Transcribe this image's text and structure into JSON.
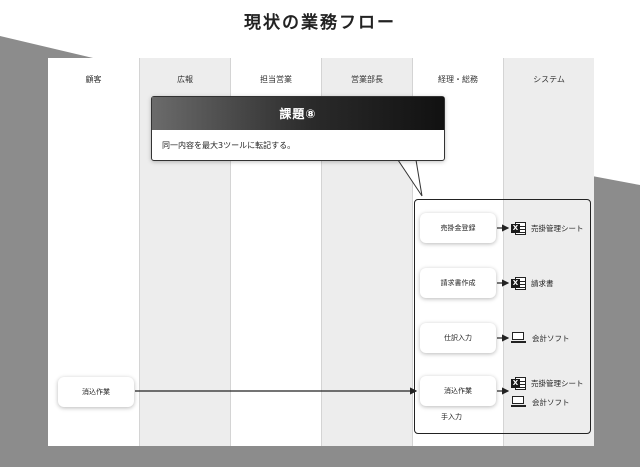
{
  "title": "現状の業務フロー",
  "lanes": [
    "顧客",
    "広報",
    "担当営業",
    "営業部長",
    "経理・総務",
    "システム"
  ],
  "callout": {
    "title": "課題⑧",
    "text": "同一内容を最大3ツールに転記する。"
  },
  "nodes": {
    "customer_task": "消込作業",
    "sales_ledger": "売掛金登録",
    "invoice": "請求書作成",
    "journal": "仕訳入力",
    "reconcile": "消込作業"
  },
  "outputs": {
    "sheet1": "売掛管理シート",
    "invoice_doc": "請求書",
    "soft1": "会計ソフト",
    "sheet2": "売掛管理シート",
    "soft2": "会計ソフト"
  },
  "icons": {
    "excel": "excel-icon",
    "laptop": "laptop-icon",
    "excel_letter": "X"
  },
  "manual_label": "手入力"
}
